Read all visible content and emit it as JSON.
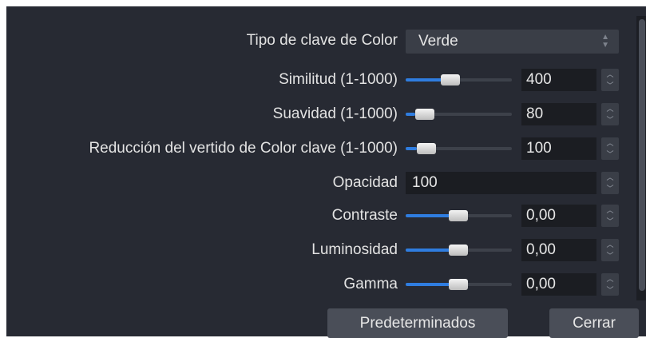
{
  "rows": {
    "key_type": {
      "label": "Tipo de clave de Color",
      "value": "Verde"
    },
    "similarity": {
      "label": "Similitud (1-1000)",
      "value": "400",
      "slider_fraction": 0.4
    },
    "smoothness": {
      "label": "Suavidad (1-1000)",
      "value": "80",
      "slider_fraction": 0.08
    },
    "spill": {
      "label": "Reducción del vertido de Color clave (1-1000)",
      "value": "100",
      "slider_fraction": 0.1
    },
    "opacity": {
      "label": "Opacidad",
      "value": "100"
    },
    "contrast": {
      "label": "Contraste",
      "value": "0,00",
      "slider_fraction": 0.5
    },
    "brightness": {
      "label": "Luminosidad",
      "value": "0,00",
      "slider_fraction": 0.5
    },
    "gamma": {
      "label": "Gamma",
      "value": "0,00",
      "slider_fraction": 0.5
    }
  },
  "buttons": {
    "defaults": "Predeterminados",
    "close": "Cerrar"
  },
  "icons": {
    "spin_up": "chevron-up-icon",
    "spin_down": "chevron-down-icon",
    "select": "updown-arrows-icon"
  },
  "colors": {
    "background": "#272a33",
    "field": "#1b1d22",
    "accent": "#2f7de0",
    "button": "#4a4e58"
  }
}
